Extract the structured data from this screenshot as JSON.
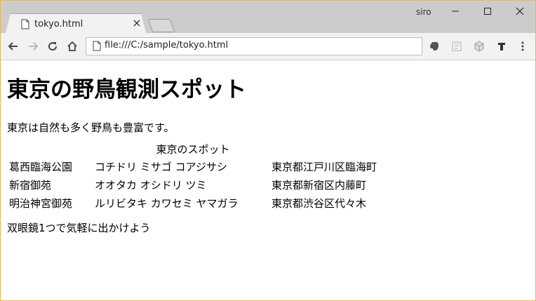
{
  "browser": {
    "user_name": "siro",
    "tab": {
      "title": "tokyo.html",
      "close": "×"
    },
    "address": {
      "url": "file:///C:/sample/tokyo.html"
    },
    "extensions": [
      "evernote-icon",
      "reader-icon",
      "cube-icon",
      "t-icon"
    ]
  },
  "page": {
    "heading": "東京の野鳥観測スポット",
    "intro": "東京は自然も多く野鳥も豊富です。",
    "table": {
      "caption": "東京のスポット",
      "rows": [
        [
          "葛西臨海公園",
          "コチドリ ミサゴ コアジサシ",
          "東京都江戸川区臨海町"
        ],
        [
          "新宿御苑",
          "オオタカ オシドリ ツミ",
          "東京都新宿区内藤町"
        ],
        [
          "明治神宮御苑",
          "ルリビタキ カワセミ ヤマガラ",
          "東京都渋谷区代々木"
        ]
      ]
    },
    "outro": "双眼鏡1つで気軽に出かけよう"
  }
}
